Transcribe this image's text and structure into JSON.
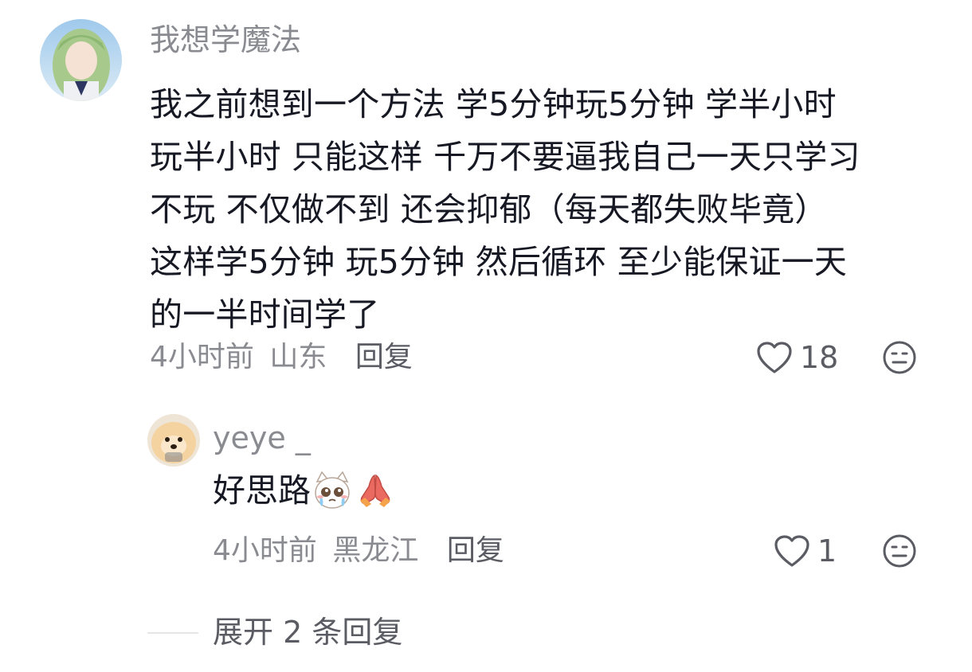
{
  "comment": {
    "username": "我想学魔法",
    "lines": [
      "我之前想到一个方法 学5分钟玩5分钟 学半小时",
      "玩半小时 只能这样 千万不要逼我自己一天只学习",
      "不玩 不仅做不到 还会抑郁（每天都失败毕竟）",
      "这样学5分钟 玩5分钟 然后循环 至少能保证一天",
      "的一半时间学了"
    ],
    "time": "4小时前",
    "location": "山东",
    "reply_label": "回复",
    "likes": "18"
  },
  "reply": {
    "username": "yeye _",
    "text": "好思路",
    "emojis": [
      "crying-cat-emoji",
      "praying-hands-emoji"
    ],
    "time": "4小时前",
    "location": "黑龙江",
    "reply_label": "回复",
    "likes": "1"
  },
  "expand": {
    "count_text": "展开 2 条回复"
  },
  "colors": {
    "text_primary": "#161823",
    "text_secondary": "#8a8b91",
    "divider": "#e6e6e8"
  },
  "icons": [
    "heart-icon",
    "dislike-face-icon"
  ]
}
